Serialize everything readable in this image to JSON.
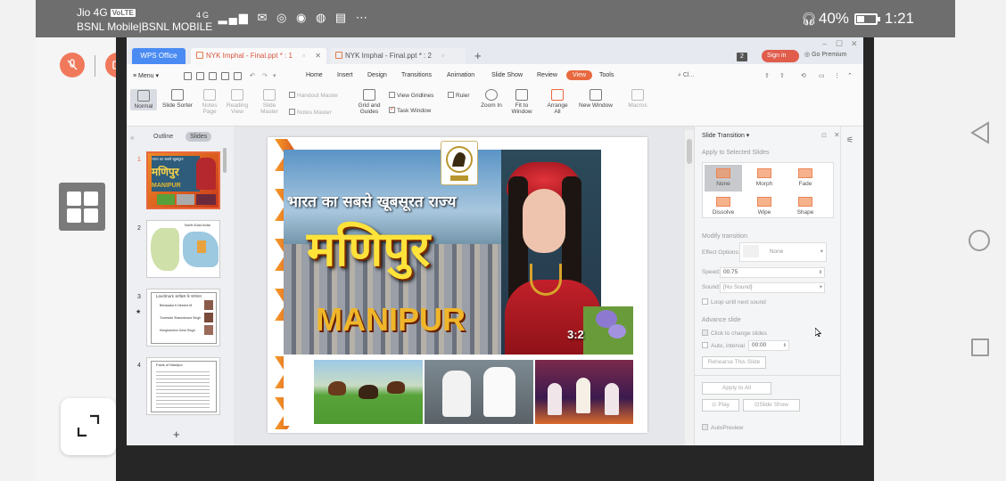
{
  "status_bar": {
    "carrier1": "Jio 4G",
    "volte_badge": "VoLTE",
    "carrier2": "BSNL Mobile|BSNL MOBILE",
    "network": "4G",
    "battery": "40%",
    "battery_level": 0.4,
    "time": "1:21"
  },
  "wps": {
    "tabs": [
      {
        "label": "WPS Office"
      },
      {
        "label": "NYK Imphal - Final.ppt * : 1"
      },
      {
        "label": "NYK Imphal - Final.ppt * : 2"
      }
    ],
    "notif_count": "2",
    "sign_in": "Sign in",
    "go_premium": "Go Premium",
    "menu_label": "Menu",
    "menu_items": [
      "Home",
      "Insert",
      "Design",
      "Transitions",
      "Animation",
      "Slide Show",
      "Review",
      "View",
      "Tools"
    ],
    "active_menu": "View",
    "search_label": "Cl...",
    "ribbon": {
      "normal": "Normal",
      "slide_sorter": "Slide Sorter",
      "notes_page": "Notes Page",
      "reading_view": "Reading View",
      "slide_master": "Slide Master",
      "handout_master": "Handout Master",
      "notes_master": "Notes Master",
      "grid_guides": "Grid and Guides",
      "view_gridlines": "View Gridlines",
      "ruler": "Ruler",
      "task_window": "Task Window",
      "zoom_in": "Zoom In",
      "fit_to_window": "Fit to Window",
      "arrange_all": "Arrange All",
      "new_window": "New Window",
      "macros": "Macros"
    },
    "panel_tabs": {
      "outline": "Outline",
      "slides": "Slides"
    },
    "slide_numbers": [
      "1",
      "2",
      "3",
      "4"
    ],
    "thumbs": {
      "t1_line1": "भारत का सबसे खूबसूरत",
      "t1_line2": "मणिपुर",
      "t1_line3": "MANIPUR",
      "t2_title": "North East India",
      "t3_title": "Landmark कार्यक्रम के नामांकन",
      "t3_rows": [
        "Brindaaba K.Neeche.M.",
        "Tommoke Shanmbraod Singh",
        "Kenghamhnn Gewi Singh"
      ],
      "t4_title": "Facts of Manipur"
    },
    "add_slide": "+",
    "slide": {
      "hindi_headline": "भारत का सबसे खूबसूरत राज्य",
      "hindi_state": "मणिपुर",
      "english_state": "MANIPUR",
      "duration": "3:2"
    },
    "transition_pane": {
      "title": "Slide Transition",
      "apply_label": "Apply to Selected Slides",
      "transitions": [
        "None",
        "Morph",
        "Fade",
        "Dissolve",
        "Wipe",
        "Shape"
      ],
      "selected": "None",
      "modify_label": "Modify transition",
      "effect_options_label": "Effect Options:",
      "effect_options_value": "None",
      "speed_label": "Speed:",
      "speed_value": "00.75",
      "sound_label": "Sound:",
      "sound_value": "[No Sound]",
      "loop_label": "Loop until next sound",
      "advance_label": "Advance slide",
      "click_label": "Click to change slides",
      "auto_label": "Auto, interval",
      "auto_value": "00:00",
      "rehearse": "Rehearse This Slide",
      "apply_all": "Apply to All",
      "play": "Play",
      "slide_show": "Slide Show",
      "autopreview": "AutoPreview"
    }
  }
}
